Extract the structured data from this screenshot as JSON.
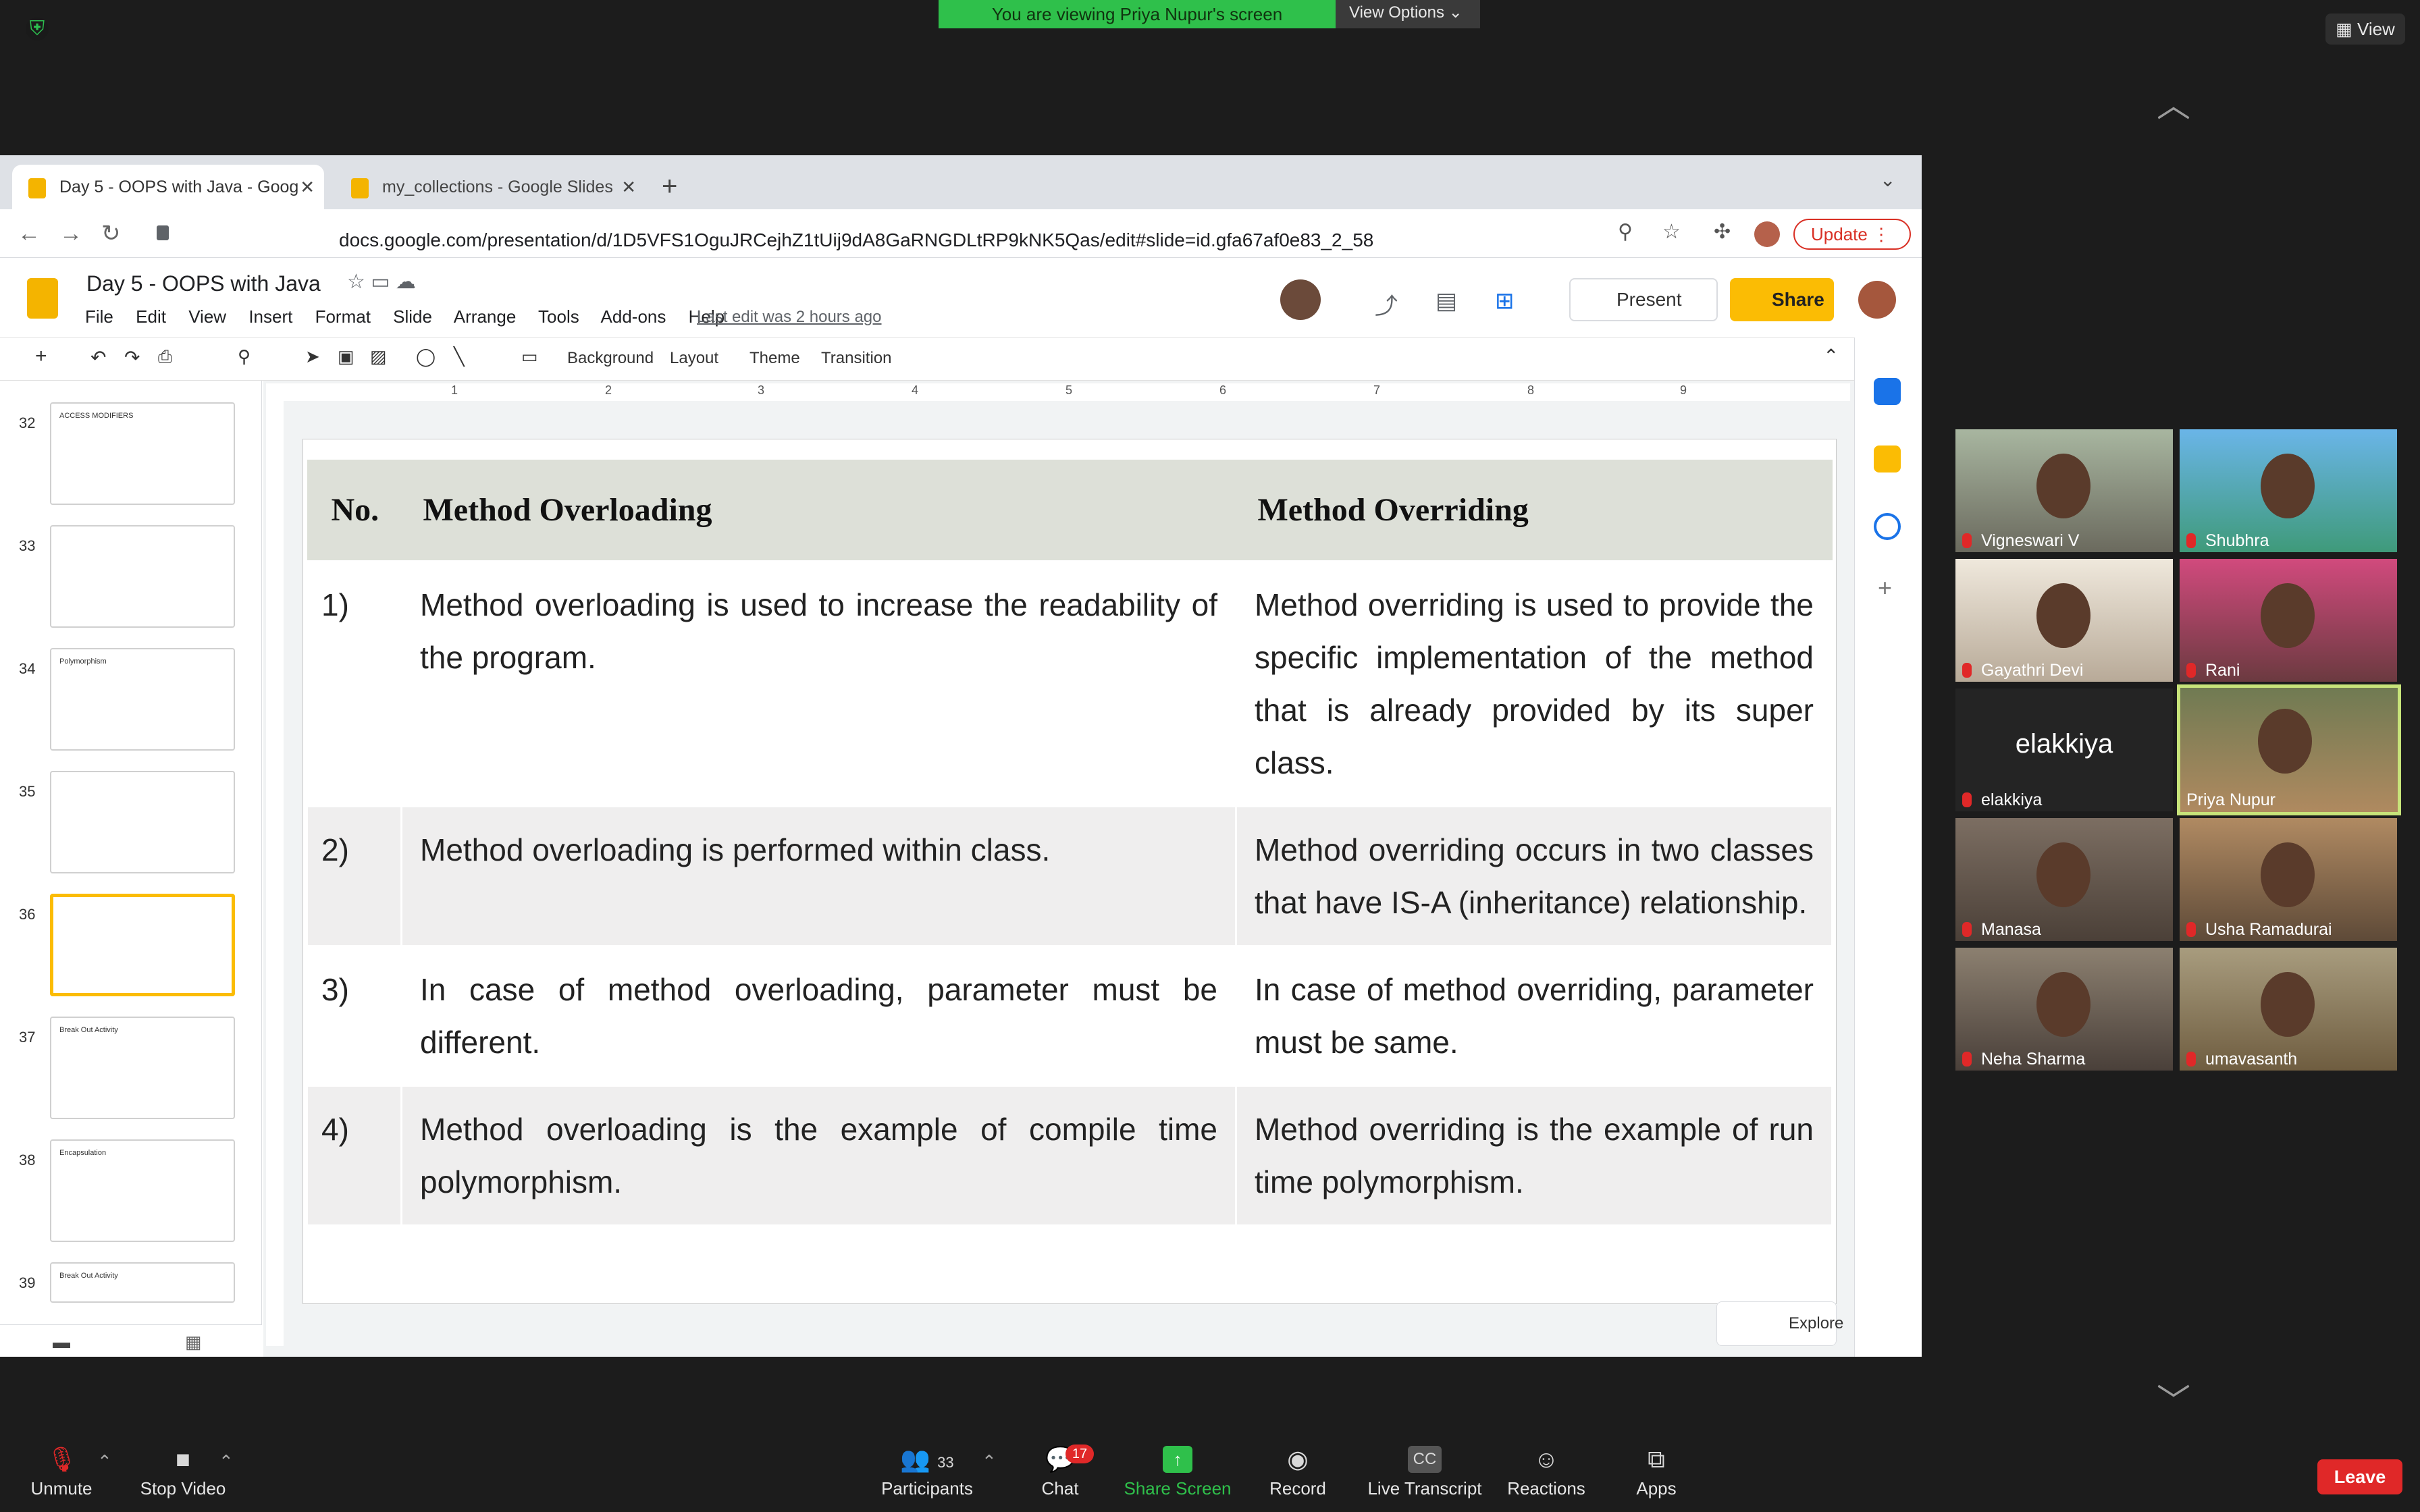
{
  "zoom": {
    "banner": "You are viewing Priya Nupur's screen",
    "view_options": "View Options ⌄",
    "view_button": "View"
  },
  "browser": {
    "tabs": [
      {
        "title": "Day 5 - OOPS with Java - Goog"
      },
      {
        "title": "my_collections - Google Slides"
      }
    ],
    "url": "docs.google.com/presentation/d/1D5VFS1OguJRCejhZ1tUij9dA8GaRNGDLtRP9kNK5Qas/edit#slide=id.gfa67af0e83_2_58",
    "update_label": "Update"
  },
  "slides_app": {
    "title": "Day 5 - OOPS with Java",
    "menu": [
      "File",
      "Edit",
      "View",
      "Insert",
      "Format",
      "Slide",
      "Arrange",
      "Tools",
      "Add-ons",
      "Help"
    ],
    "last_edit": "Last edit was 2 hours ago",
    "present_label": "Present",
    "share_label": "Share",
    "toolbar": {
      "background": "Background",
      "layout": "Layout",
      "theme": "Theme",
      "transition": "Transition"
    },
    "ruler_numbers": [
      "1",
      "2",
      "3",
      "4",
      "5",
      "6",
      "7",
      "8",
      "9"
    ],
    "explore_label": "Explore"
  },
  "filmstrip": [
    {
      "num": "32",
      "text": "ACCESS MODIFIERS"
    },
    {
      "num": "33",
      "text": ""
    },
    {
      "num": "34",
      "text": "Polymorphism"
    },
    {
      "num": "35",
      "text": ""
    },
    {
      "num": "36",
      "text": ""
    },
    {
      "num": "37",
      "text": "Break Out Activity"
    },
    {
      "num": "38",
      "text": "Encapsulation"
    },
    {
      "num": "39",
      "text": "Break Out Activity"
    }
  ],
  "slide": {
    "headers": [
      "No.",
      "Method Overloading",
      "Method Overriding"
    ],
    "rows": [
      {
        "num": "1)",
        "overloading": "Method overloading is used to increase the readability of the program.",
        "overriding": "Method overriding is used to provide the specific implementation of the method that is already provided by its super class."
      },
      {
        "num": "2)",
        "overloading": "Method overloading is performed within class.",
        "overriding": "Method overriding occurs in two classes that have IS-A (inheritance) relationship."
      },
      {
        "num": "3)",
        "overloading": "In case of method overloading, parameter must be different.",
        "overriding": "In case of method overriding, parameter must be same."
      },
      {
        "num": "4)",
        "overloading": "Method overloading is the example of compile time polymorphism.",
        "overriding": "Method overriding is the example of run time polymorphism."
      }
    ]
  },
  "participants": [
    {
      "name": "Vigneswari V",
      "muted": true
    },
    {
      "name": "Shubhra",
      "muted": true
    },
    {
      "name": "Gayathri Devi",
      "muted": true
    },
    {
      "name": "Rani",
      "muted": true
    },
    {
      "name": "elakkiya",
      "muted": true,
      "video_off_name": "elakkiya"
    },
    {
      "name": "Priya Nupur",
      "muted": false
    },
    {
      "name": "Manasa",
      "muted": true
    },
    {
      "name": "Usha Ramadurai",
      "muted": true
    },
    {
      "name": "Neha Sharma",
      "muted": true
    },
    {
      "name": "umavasanth",
      "muted": true
    }
  ],
  "bottom_bar": {
    "unmute": "Unmute",
    "stop_video": "Stop Video",
    "participants": "Participants",
    "participants_count": "33",
    "chat": "Chat",
    "chat_badge": "17",
    "share_screen": "Share Screen",
    "record": "Record",
    "live_transcript": "Live Transcript",
    "reactions": "Reactions",
    "apps": "Apps",
    "leave": "Leave"
  },
  "colors": {
    "zoom_green": "#2fc04b",
    "slides_yellow": "#fbbc04",
    "leave_red": "#e02828",
    "active_speaker": "#c7e37a"
  }
}
